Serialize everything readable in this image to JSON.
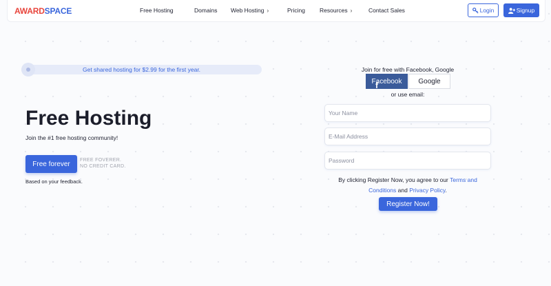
{
  "header": {
    "logo_part1": "AWARD",
    "logo_part2": "SPACE",
    "nav": {
      "free_hosting": "Free Hosting",
      "domains": "Domains",
      "web_hosting": "Web Hosting",
      "pricing": "Pricing",
      "resources": "Resources",
      "contact_sales": "Contact Sales"
    },
    "login_label": "Login",
    "signup_label": "Signup"
  },
  "hero": {
    "promo_text": "Get shared hosting for $2.99 for the first year.",
    "title": "Free Hosting",
    "subtitle": "Join the #1 free hosting community!",
    "cta_label": "Free forever",
    "cta_note": "FREE FOVERER. NO CREDIT CARD.",
    "feedback_note": "Based on your feedback."
  },
  "register": {
    "join_text": "Join for free with Facebook, Google",
    "facebook_label": "Facebook",
    "google_label": "Google",
    "or_email": "or use email:",
    "name_placeholder": "Your Name",
    "email_placeholder": "E-Mail Address",
    "password_placeholder": "Password",
    "terms_prefix": "By clicking Register Now, you agree to our ",
    "terms_link": "Terms and Conditions",
    "terms_and": " and ",
    "privacy_link": "Privacy Policy",
    "terms_suffix": ".",
    "submit_label": "Register Now!"
  },
  "icons": {
    "login": "key-icon",
    "signup": "user-plus-icon",
    "facebook": "facebook-icon",
    "chevron": "chevron-right-icon"
  },
  "colors": {
    "accent": "#3a66dc",
    "logo_red": "#e8453c",
    "facebook": "#3a5b9a"
  }
}
